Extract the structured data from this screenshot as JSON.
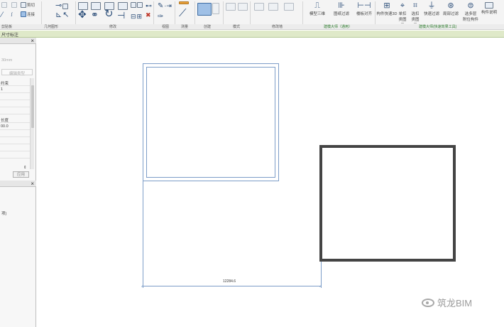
{
  "ribbon": {
    "clipboard": {
      "cut_label": "剪切",
      "join_label": "连接"
    },
    "group_labels": {
      "clipboard": "剪贴板",
      "geometry": "几何图形",
      "modify": "修改",
      "view": "视图",
      "measure": "测量",
      "create": "创建",
      "mode": "模式",
      "edit_text": "修改墙",
      "architecture_master": "建模大师（通用）",
      "efficiency_tools": "建模大师(快速效果工具)"
    },
    "master_tools": [
      {
        "label": "模型三维"
      },
      {
        "label": "图纸过滤"
      },
      {
        "label": "楼板对齐"
      }
    ],
    "efficiency_tools": [
      {
        "label": "构件快速3D"
      },
      {
        "label": "单扣 类图元"
      },
      {
        "label": "选扣 类图元"
      },
      {
        "label": "快速过滤"
      },
      {
        "label": "局部过滤"
      },
      {
        "label": "选多层 附位构件"
      },
      {
        "label": "构件说明"
      }
    ]
  },
  "context_bar": {
    "label": "尺寸标注"
  },
  "properties_panel": {
    "unit_hint": "30mm",
    "edit_type_label": "编辑类型",
    "row_1": "约束",
    "row_2": "1",
    "row_3": "长度",
    "row_4": "00.0",
    "apply_label": "应用"
  },
  "browser_panel": {
    "item": "项)"
  },
  "canvas": {
    "dimension_value": "12284.6"
  },
  "watermark": {
    "text": "筑龙BIM"
  },
  "colors": {
    "selection": "#7d9dc8",
    "wall": "#444444",
    "context_bar": "#dfe9c9"
  }
}
